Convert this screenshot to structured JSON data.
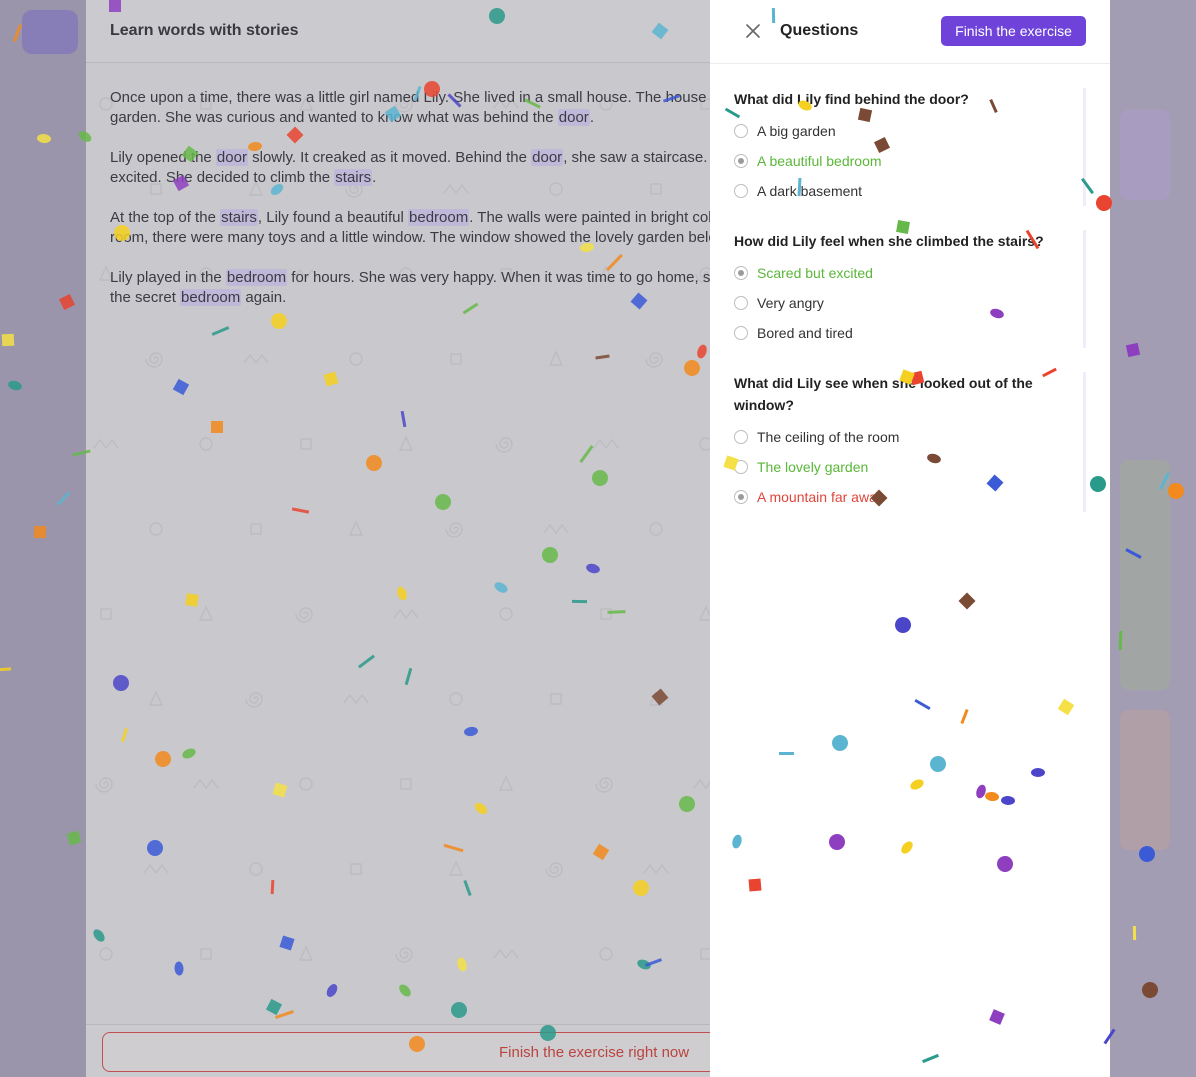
{
  "reader": {
    "title": "Learn words with stories",
    "paragraphs": [
      [
        {
          "t": "Once upon a time, there was a little girl named Lily. She lived in a small house. The house had a"
        },
        {
          "br": true
        },
        {
          "t": "garden. She was curious and wanted to know what was behind the "
        },
        {
          "t": "door",
          "hl": true
        },
        {
          "t": "."
        }
      ],
      [
        {
          "t": "Lily opened the "
        },
        {
          "t": "door",
          "hl": true
        },
        {
          "t": " slowly. It creaked as it moved. Behind the "
        },
        {
          "t": "door",
          "hl": true
        },
        {
          "t": ", she saw a staircase. The girl was"
        },
        {
          "br": true
        },
        {
          "t": "excited. She decided to climb the "
        },
        {
          "t": "stairs",
          "hl": true
        },
        {
          "t": "."
        }
      ],
      [
        {
          "t": "At the top of the "
        },
        {
          "t": "stairs",
          "hl": true
        },
        {
          "t": ", Lily found a beautiful "
        },
        {
          "t": "bedroom",
          "hl": true
        },
        {
          "t": ". The walls were painted in bright colors. In the"
        },
        {
          "br": true
        },
        {
          "t": "room, there were many toys and a little window. The window showed the lovely garden below."
        }
      ],
      [
        {
          "t": "Lily played in the "
        },
        {
          "t": "bedroom",
          "hl": true
        },
        {
          "t": " for hours. She was very happy. When it was time to go home, she promised to visit"
        },
        {
          "br": true
        },
        {
          "t": "the secret "
        },
        {
          "t": "bedroom",
          "hl": true
        },
        {
          "t": " again."
        }
      ]
    ],
    "finish_now_label": "Finish the exercise right now"
  },
  "panel": {
    "title": "Questions",
    "finish_label": "Finish the exercise",
    "close_icon": "close-icon"
  },
  "questions": [
    {
      "text": "What did Lily find behind the door?",
      "options": [
        {
          "label": "A big garden",
          "checked": false,
          "state": "neutral"
        },
        {
          "label": "A beautiful bedroom",
          "checked": true,
          "state": "correct"
        },
        {
          "label": "A dark basement",
          "checked": false,
          "state": "neutral"
        }
      ]
    },
    {
      "text": "How did Lily feel when she climbed the stairs?",
      "options": [
        {
          "label": "Scared but excited",
          "checked": true,
          "state": "correct"
        },
        {
          "label": "Very angry",
          "checked": false,
          "state": "neutral"
        },
        {
          "label": "Bored and tired",
          "checked": false,
          "state": "neutral"
        }
      ]
    },
    {
      "text": "What did Lily see when she looked out of the window?",
      "options": [
        {
          "label": "The ceiling of the room",
          "checked": false,
          "state": "neutral"
        },
        {
          "label": "The lovely garden",
          "checked": false,
          "state": "correct"
        },
        {
          "label": "A mountain far away",
          "checked": true,
          "state": "wrong"
        }
      ]
    }
  ],
  "colors": {
    "accent": "#6f43d9",
    "correct": "#5ab738",
    "wrong": "#e0453a",
    "highlight": "#bfb8d8"
  }
}
